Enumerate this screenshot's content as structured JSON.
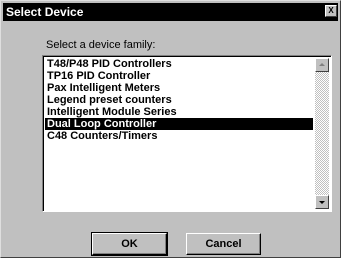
{
  "window": {
    "title": "Select Device",
    "close_label": "X"
  },
  "dialog": {
    "prompt": "Select a device family:",
    "items": [
      "T48/P48 PID Controllers",
      "TP16 PID Controller",
      "Pax Intelligent Meters",
      "Legend preset counters",
      "Intelligent Module Series",
      "Dual Loop Controller",
      "C48 Counters/Timers"
    ],
    "selected_item": "Dual Loop Controller"
  },
  "buttons": {
    "ok_label": "OK",
    "cancel_label": "Cancel"
  },
  "colors": {
    "titlebar": "#000000",
    "dialog_bg": "#c0c0c0",
    "selection_bg": "#000000",
    "selection_fg": "#ffffff"
  }
}
